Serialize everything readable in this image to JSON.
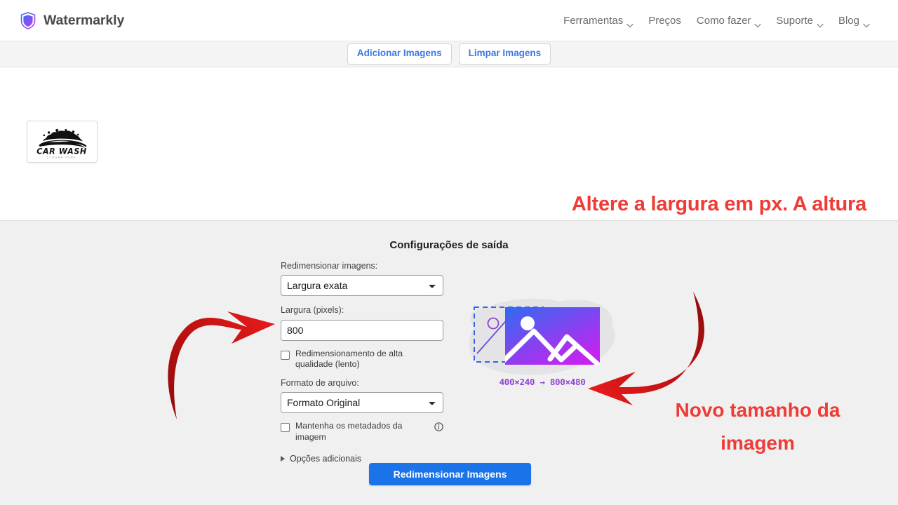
{
  "header": {
    "brand_name": "Watermarkly",
    "logo_icon": "shield-icon",
    "nav": [
      {
        "label": "Ferramentas",
        "has_caret": true
      },
      {
        "label": "Preços",
        "has_caret": false
      },
      {
        "label": "Como fazer",
        "has_caret": true
      },
      {
        "label": "Suporte",
        "has_caret": true
      },
      {
        "label": "Blog",
        "has_caret": true
      }
    ]
  },
  "toolbar": {
    "add_images_label": "Adicionar Imagens",
    "clear_images_label": "Limpar Imagens"
  },
  "image_strip": {
    "thumbnail": {
      "title": "CAR WASH",
      "subtitle": "SLOGAN HERE"
    }
  },
  "annotations": {
    "top": "Altere a largura em px. A altura será aumentada automaticamente.",
    "bottom": "Novo tamanho da imagem",
    "color": "#ef3b36",
    "arrow_color": "#b51111",
    "left_arrow": "curved-arrow-right-icon",
    "right_arrow": "curved-arrow-left-icon"
  },
  "settings": {
    "title": "Configurações de saída",
    "resize_label": "Redimensionar imagens:",
    "resize_value": "Largura exata",
    "resize_options": [
      "Largura exata"
    ],
    "width_label": "Largura (pixels):",
    "width_value": "800",
    "width_placeholder": "",
    "hq_checkbox_label": "Redimensionamento de alta qualidade (lento)",
    "hq_checked": false,
    "format_label": "Formato de arquivo:",
    "format_value": "Formato Original",
    "format_options": [
      "Formato Original"
    ],
    "metadata_checkbox_label": "Mantenha os metadados da imagem",
    "metadata_checked": false,
    "metadata_info_icon": "info-icon",
    "additional_options_label": "Opções adicionais",
    "additional_options_icon": "triangle-right-icon",
    "submit_label": "Redimensionar Imagens",
    "submit_color": "#1a73e8"
  },
  "illustration": {
    "caption": "400×240 → 800×480",
    "caption_color": "#8e44d4",
    "small_box_label": "400×240",
    "large_box_label": "800×480",
    "gradient_from": "#2f6bf0",
    "gradient_to": "#c822f0"
  }
}
